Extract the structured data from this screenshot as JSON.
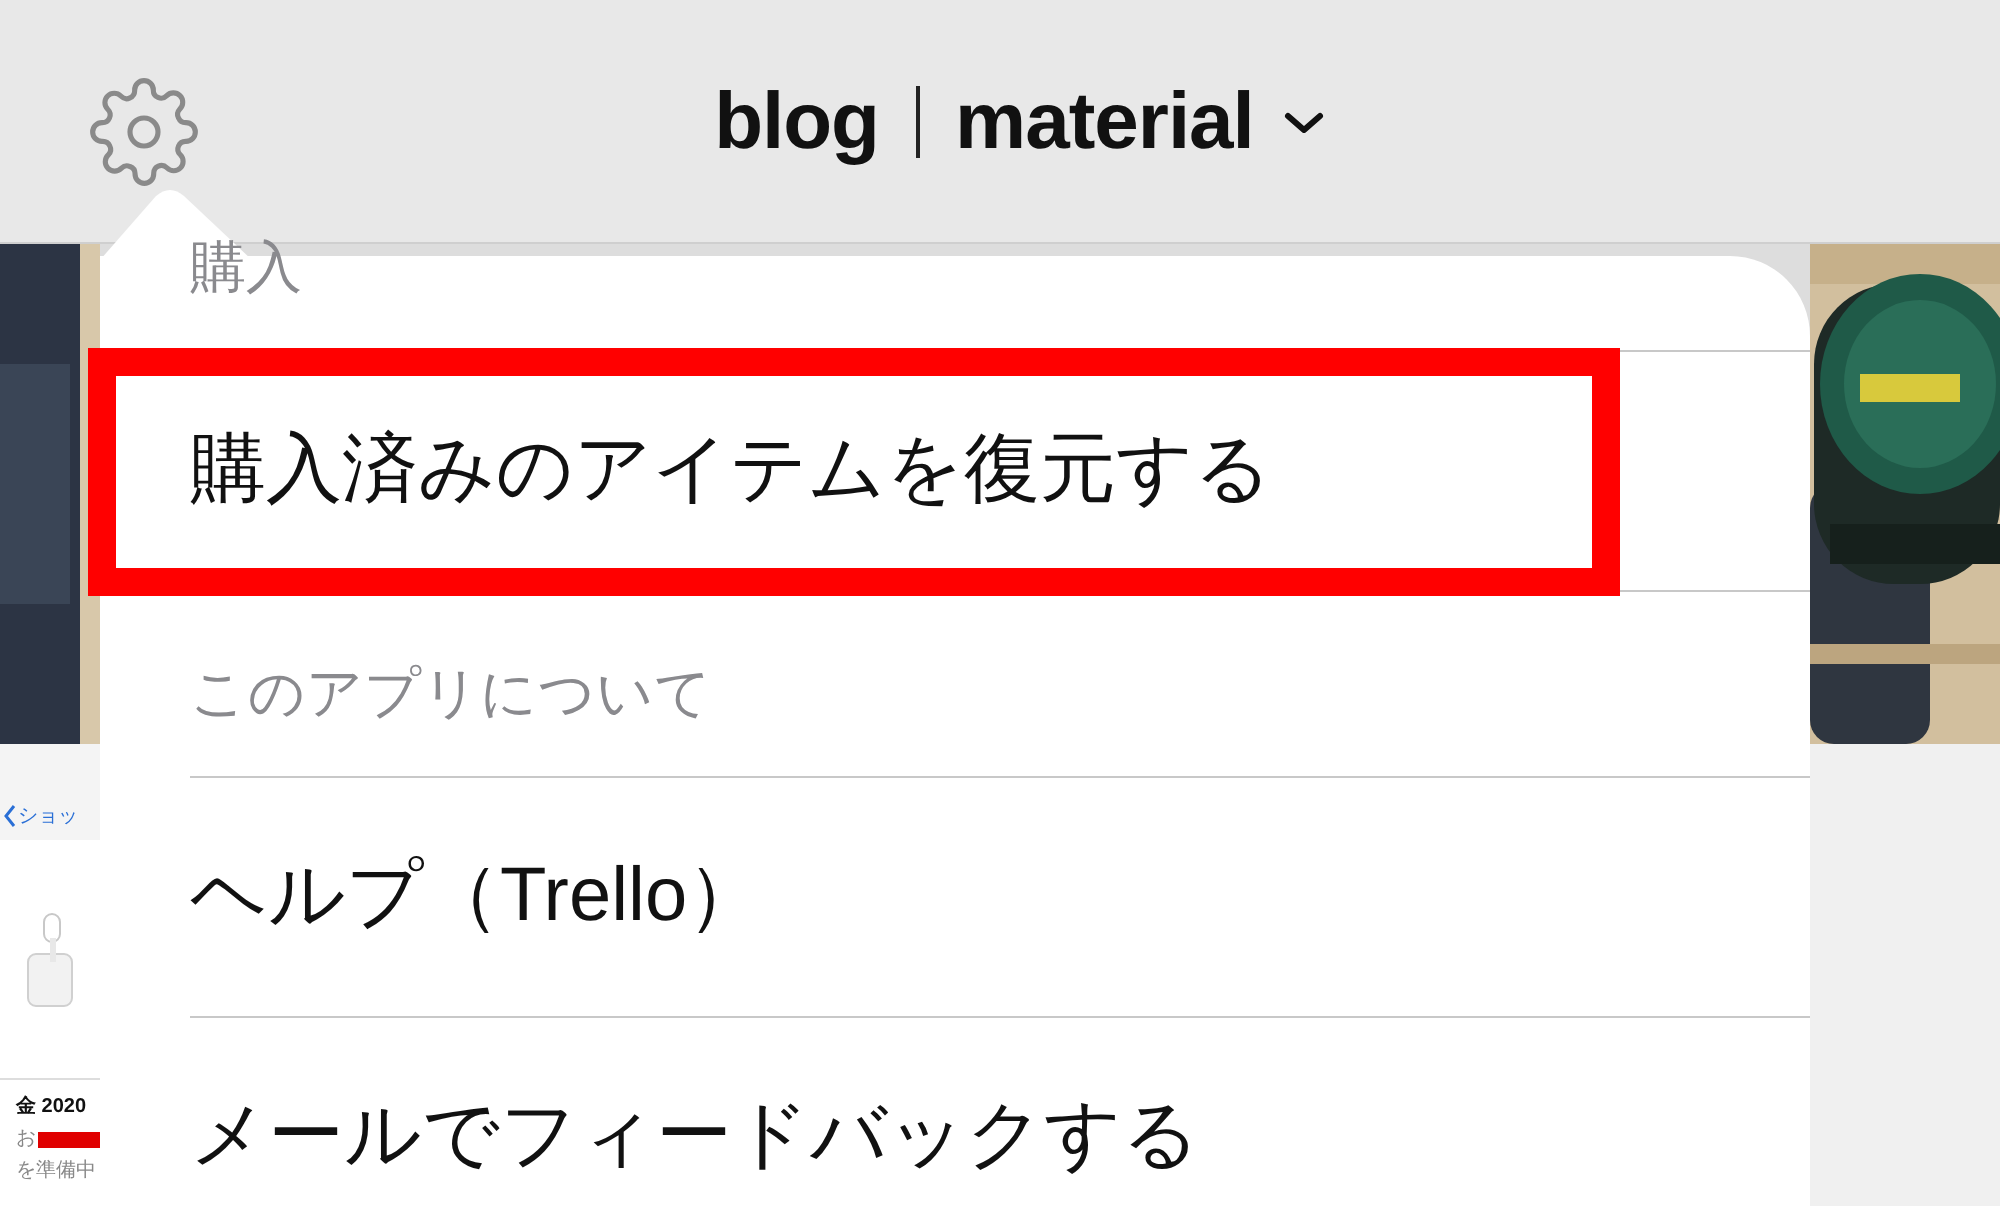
{
  "header": {
    "title_left": "blog",
    "title_right": "material"
  },
  "thumbnail": {
    "back_label": "ショッ",
    "date": "金 2020",
    "line_1": "お",
    "line_2": "を準備中"
  },
  "menu": {
    "items": [
      {
        "kind": "section",
        "label": "購入",
        "highlighted": false
      },
      {
        "kind": "action",
        "label": "購入済みのアイテムを復元する",
        "highlighted": true
      },
      {
        "kind": "section",
        "label": "このアプリについて",
        "highlighted": false
      },
      {
        "kind": "action",
        "label": "ヘルプ（Trello）",
        "highlighted": false
      },
      {
        "kind": "action",
        "label": "メールでフィードバックする",
        "highlighted": false
      }
    ]
  }
}
